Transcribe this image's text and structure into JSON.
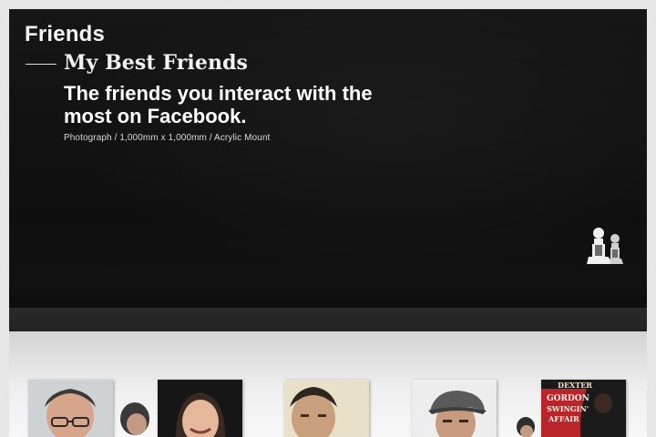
{
  "section": {
    "title": "Friends"
  },
  "work": {
    "title": "My Best Friends",
    "description": "The friends you interact with the most on Facebook.",
    "caption": "Photograph / 1,000mm x 1,000mm / Acrylic Mount"
  },
  "album": {
    "photo5_text": {
      "line1": "DEXTER",
      "line2": "GORDON",
      "line3": "SWINGIN'",
      "line4": "AFFAIR"
    }
  },
  "icons": {
    "friends": "friends-icon"
  },
  "colors": {
    "panel": "#141414",
    "strip": "#262626",
    "text": "#ffffff",
    "wall": "#e8e8e8"
  }
}
